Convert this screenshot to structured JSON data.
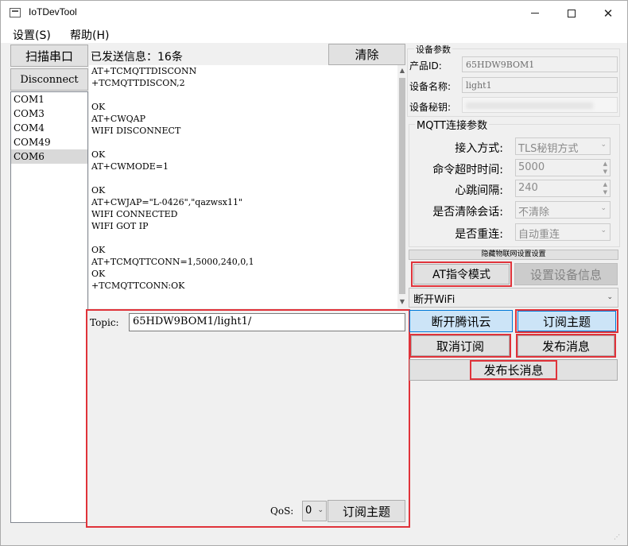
{
  "window": {
    "title": "IoTDevTool",
    "controls": {
      "minimize": "─",
      "maximize": "☐",
      "close": "✕"
    }
  },
  "menu": {
    "settings": "设置(S)",
    "help": "帮助(H)"
  },
  "left": {
    "scan_button": "扫描串口",
    "disconnect_button": "Disconnect",
    "ports": [
      "COM1",
      "COM3",
      "COM4",
      "COM49",
      "COM6"
    ],
    "selected_port": "COM6"
  },
  "log": {
    "sent_info": "已发送信息：16条",
    "clear_button": "清除",
    "lines": "AT+TCMQTTDISCONN\n+TCMQTTDISCON,2\n\nOK\nAT+CWQAP\nWIFI DISCONNECT\n\nOK\nAT+CWMODE=1\n\nOK\nAT+CWJAP=\"L-0426\",\"qazwsx11\"\nWIFI CONNECTED\nWIFI GOT IP\n\nOK\nAT+TCMQTTCONN=1,5000,240,0,1\nOK\n+TCMQTTCONN:OK"
  },
  "topic_panel": {
    "topic_label": "Topic:",
    "topic_value": "65HDW9BOM1/light1/",
    "qos_label": "QoS:",
    "qos_value": "0",
    "subscribe_button": "订阅主题"
  },
  "device_params": {
    "group_title": "设备参数",
    "product_id_label": "产品ID:",
    "product_id_value": "65HDW9BOM1",
    "device_name_label": "设备名称:",
    "device_name_value": "light1",
    "device_secret_label": "设备秘钥:"
  },
  "mqtt_params": {
    "group_title": "MQTT连接参数",
    "access_mode_label": "接入方式:",
    "access_mode_value": "TLS秘钥方式",
    "cmd_timeout_label": "命令超时时间:",
    "cmd_timeout_value": "5000",
    "heartbeat_label": "心跳间隔:",
    "heartbeat_value": "240",
    "clean_session_label": "是否清除会话:",
    "clean_session_value": "不清除",
    "reconnect_label": "是否重连:",
    "reconnect_value": "自动重连"
  },
  "actions": {
    "hide_iot_settings": "隐藏物联网设置设置",
    "at_mode_button": "AT指令模式",
    "set_device_info_button": "设置设备信息",
    "wifi_combo_value": "断开WiFi",
    "disconnect_cloud_button": "断开腾讯云",
    "subscribe_topic_button": "订阅主题",
    "unsubscribe_button": "取消订阅",
    "publish_button": "发布消息",
    "publish_long_button": "发布长消息"
  }
}
